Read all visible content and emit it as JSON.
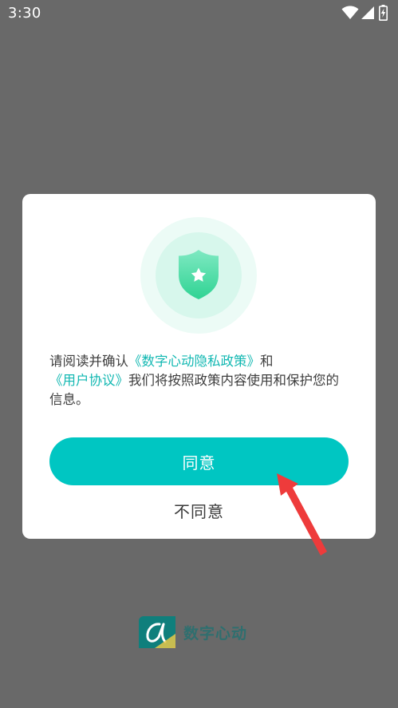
{
  "status_bar": {
    "time": "3:30",
    "icons": [
      "wifi-icon",
      "cellular-signal-icon",
      "battery-charging-icon"
    ]
  },
  "dialog": {
    "icon": "shield-star-icon",
    "text_before_policy": "请阅读并确认",
    "privacy_policy_link": "《数字心动隐私政策》",
    "text_and": "和",
    "user_agreement_link": "《用户协议》",
    "text_after": "我们将按照政策内容使用和保护您的信息。",
    "agree_label": "同意",
    "disagree_label": "不同意"
  },
  "brand": {
    "name": "数字心动",
    "logo": "digital-heartbeat-logo-icon"
  },
  "colors": {
    "overlay": "#696969",
    "accent": "#00c6c2",
    "link": "#12b8b2",
    "arrow": "#ee3b3b"
  }
}
